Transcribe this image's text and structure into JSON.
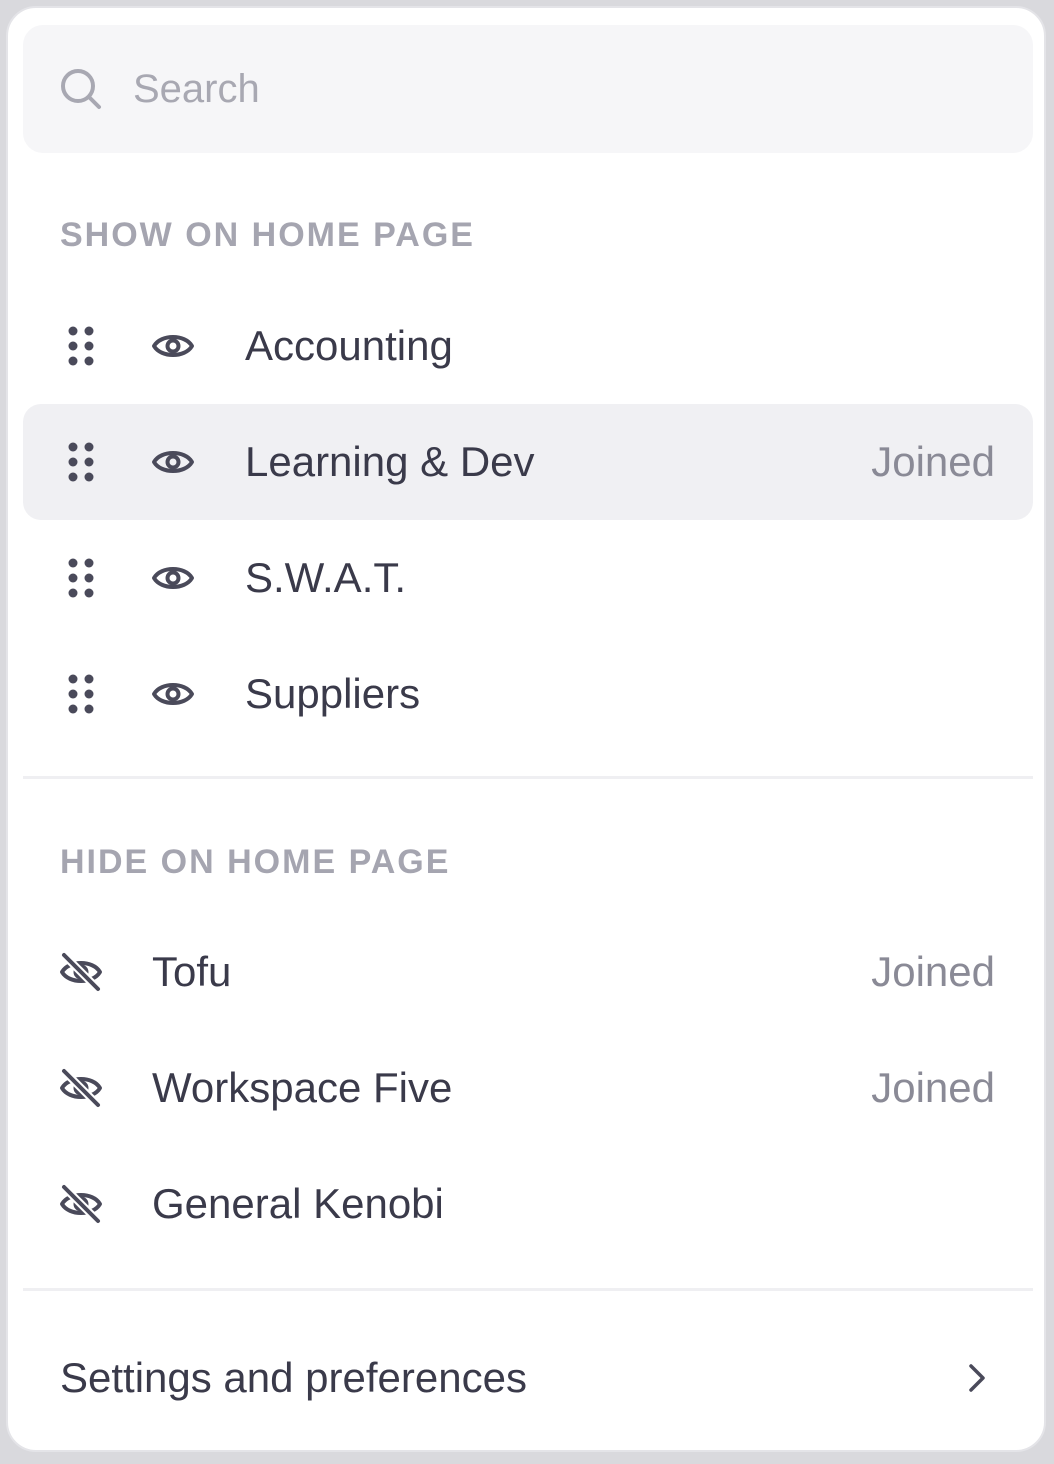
{
  "search": {
    "placeholder": "Search",
    "icon": "search-icon"
  },
  "show_section": {
    "title": "SHOW ON HOME PAGE",
    "items": [
      {
        "label": "Accounting",
        "badge": "",
        "highlighted": false
      },
      {
        "label": "Learning & Dev",
        "badge": "Joined",
        "highlighted": true
      },
      {
        "label": "S.W.A.T.",
        "badge": "",
        "highlighted": false
      },
      {
        "label": "Suppliers",
        "badge": "",
        "highlighted": false
      }
    ]
  },
  "hide_section": {
    "title": "HIDE ON HOME PAGE",
    "items": [
      {
        "label": "Tofu",
        "badge": "Joined"
      },
      {
        "label": "Workspace Five",
        "badge": "Joined"
      },
      {
        "label": "General Kenobi",
        "badge": ""
      }
    ]
  },
  "footer": {
    "settings_label": "Settings and preferences",
    "icon": "chevron-right-icon"
  },
  "colors": {
    "text": "#3a3a4a",
    "muted": "#a5a5b0",
    "badge": "#8a8a96",
    "highlight": "#f0f0f3",
    "search_bg": "#f6f6f8"
  }
}
